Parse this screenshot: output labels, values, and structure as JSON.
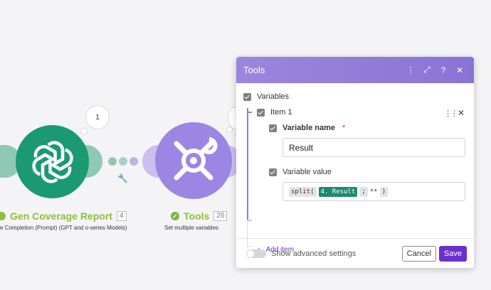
{
  "canvas": {
    "openai_module": {
      "title": "Gen Coverage Report",
      "number": "4",
      "subtitle": "e Completion (Prompt) (GPT and o-series Models)",
      "bubble": "1",
      "color": "#1b9a72"
    },
    "tools_module": {
      "title": "Tools",
      "number": "26",
      "subtitle": "Set multiple variables",
      "color": "#9b86e3"
    },
    "title_color": "#8bbf3e"
  },
  "dialog": {
    "title": "Tools",
    "header_icons": [
      "more-icon",
      "expand-icon",
      "help-icon",
      "close-icon"
    ],
    "header_glyphs": {
      "more": "⋮",
      "expand": "⤢",
      "help": "?",
      "close": "✕"
    },
    "section_label": "Variables",
    "item_label": "Item 1",
    "variable_name_label": "Variable name",
    "required_mark": "*",
    "variable_name_value": "Result",
    "variable_value_label": "Variable value",
    "expression": {
      "fn_open": "split(",
      "ref": "4. Result",
      "separator": ";",
      "literal": "**",
      "close": ")"
    },
    "add_item_label": "Add item",
    "advanced_label": "Show advanced settings",
    "cancel_label": "Cancel",
    "save_label": "Save",
    "accent": "#6a2fcc"
  }
}
